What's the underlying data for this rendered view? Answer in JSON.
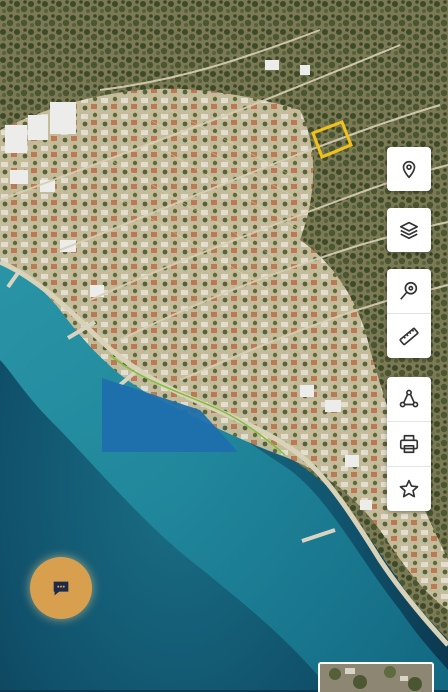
{
  "map": {
    "parcel_label": "",
    "colors": {
      "sea_deep": "#0b3347",
      "sea_shallow": "#1d8296",
      "land": "#b9ad8a",
      "vegetation": "#4d5a33",
      "highlight_parcel": "#f2c21b",
      "water_polygon": "#1f6fad",
      "coast_line": "#7fbf3b"
    }
  },
  "toolbar": {
    "groups": [
      [
        {
          "icon": "location-pin-icon"
        }
      ],
      [
        {
          "icon": "layers-icon"
        }
      ],
      [
        {
          "icon": "search-location-icon"
        },
        {
          "icon": "ruler-icon"
        }
      ],
      [
        {
          "icon": "share-icon"
        },
        {
          "icon": "print-icon"
        },
        {
          "icon": "star-icon"
        }
      ]
    ]
  },
  "chat": {
    "icon": "chat-bubble-icon",
    "color": "#d8a04e"
  },
  "basemap_thumbnail": {
    "icon": "basemap-thumbnail"
  }
}
